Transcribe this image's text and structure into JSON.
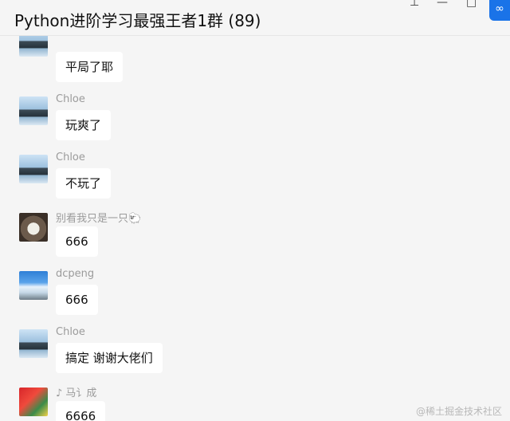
{
  "window": {
    "title": "Python进阶学习最强王者1群 (89)",
    "controls": {
      "pin": "⊥",
      "minimize": "—",
      "maximize": "□"
    },
    "corner_badge": "∞"
  },
  "messages": [
    {
      "sender": "",
      "text": "平局了耶",
      "avatar": "tree"
    },
    {
      "sender": "Chloe",
      "text": "玩爽了",
      "avatar": "tree"
    },
    {
      "sender": "Chloe",
      "text": "不玩了",
      "avatar": "tree"
    },
    {
      "sender": "别看我只是一只🐑",
      "text": "666",
      "avatar": "cat"
    },
    {
      "sender": "dcpeng",
      "text": "666",
      "avatar": "sky"
    },
    {
      "sender": "Chloe",
      "text": "搞定 谢谢大佬们",
      "avatar": "tree"
    },
    {
      "sender": "♪ 马讠成",
      "text": "6666",
      "avatar": "red"
    }
  ],
  "watermark": "@稀土掘金技术社区"
}
